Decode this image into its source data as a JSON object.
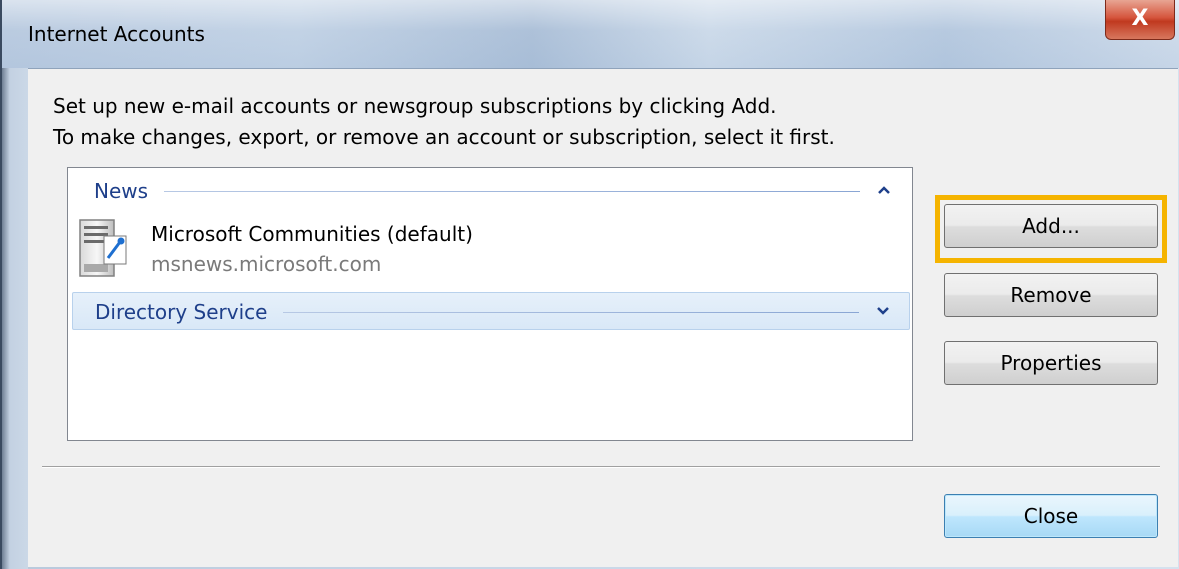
{
  "window": {
    "title": "Internet Accounts",
    "close_glyph": "X"
  },
  "intro": {
    "line1": "Set up new e-mail accounts or newsgroup subscriptions by clicking Add.",
    "line2": "To make changes, export, or remove an account or subscription, select it first."
  },
  "list": {
    "groups": [
      {
        "label": "News",
        "expanded": true,
        "chevron": "up-chevron-icon",
        "accounts": [
          {
            "name": "Microsoft Communities (default)",
            "server": "msnews.microsoft.com",
            "icon": "news-server-icon"
          }
        ]
      },
      {
        "label": "Directory Service",
        "expanded": false,
        "chevron": "down-chevron-icon",
        "accounts": []
      }
    ]
  },
  "buttons": {
    "add": "Add...",
    "remove": "Remove",
    "properties": "Properties",
    "close": "Close"
  },
  "colors": {
    "highlight": "#f5b400",
    "group_text": "#1e3f8a",
    "close_button": "#c0391f"
  }
}
